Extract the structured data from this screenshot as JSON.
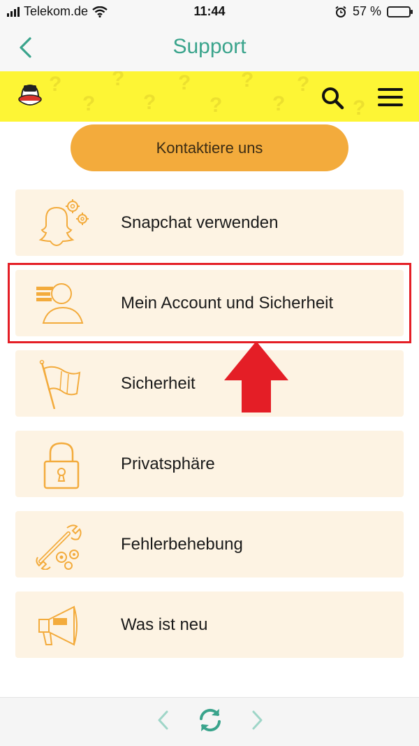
{
  "status_bar": {
    "carrier": "Telekom.de",
    "time": "11:44",
    "battery_text": "57 %",
    "battery_level": 0.57
  },
  "navbar": {
    "title": "Support"
  },
  "contact_button": {
    "label": "Kontaktiere uns"
  },
  "categories": [
    {
      "label": "Snapchat verwenden",
      "icon": "ghost-gears-icon"
    },
    {
      "label": "Mein Account und Sicherheit",
      "icon": "user-profile-icon"
    },
    {
      "label": "Sicherheit",
      "icon": "flag-icon"
    },
    {
      "label": "Privatsphäre",
      "icon": "padlock-icon"
    },
    {
      "label": "Fehlerbehebung",
      "icon": "wrench-gears-icon"
    },
    {
      "label": "Was ist neu",
      "icon": "megaphone-icon"
    }
  ],
  "colors": {
    "accent": "#3aa48c",
    "header_yellow": "#fdf535",
    "button_orange": "#f3ab3c",
    "card_background": "#fdf3e3",
    "icon_orange": "#f3ab3c",
    "highlight_red": "#e41e26"
  }
}
